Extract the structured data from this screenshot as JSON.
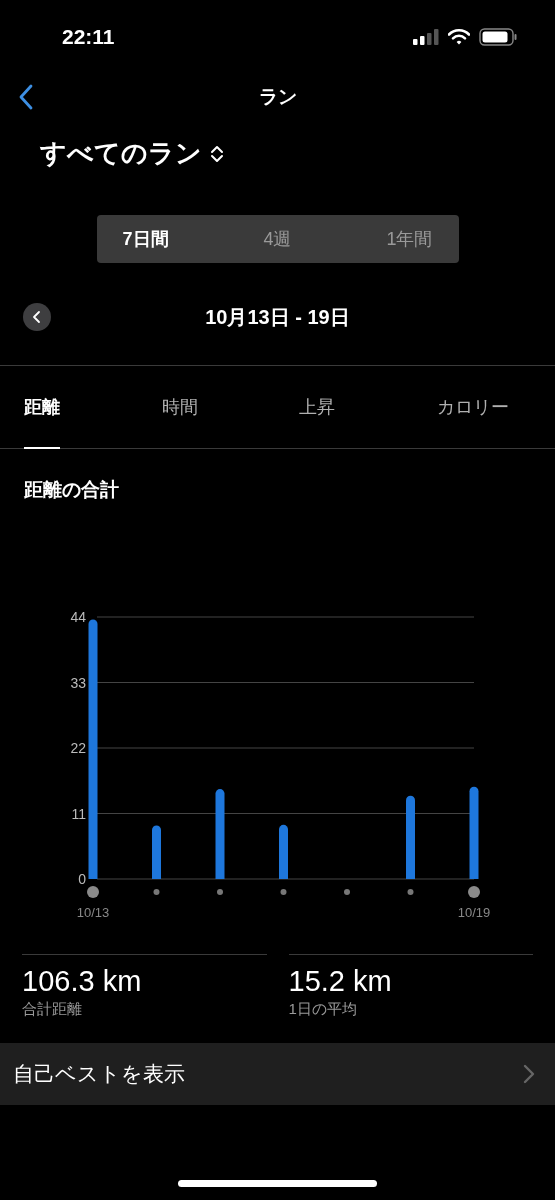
{
  "status_bar": {
    "time": "22:11"
  },
  "nav": {
    "title": "ラン"
  },
  "filter": {
    "label": "すべてのラン"
  },
  "period_tabs": [
    {
      "label": "7日間",
      "selected": true
    },
    {
      "label": "4週",
      "selected": false
    },
    {
      "label": "1年間",
      "selected": false
    }
  ],
  "date_range": {
    "label": "10月13日 - 19日"
  },
  "metric_tabs": [
    {
      "label": "距離",
      "selected": true
    },
    {
      "label": "時間",
      "selected": false
    },
    {
      "label": "上昇",
      "selected": false
    },
    {
      "label": "カロリー",
      "selected": false
    }
  ],
  "section": {
    "title": "距離の合計",
    "chart_data": {
      "type": "bar",
      "categories": [
        "10/13",
        null,
        null,
        null,
        null,
        null,
        "10/19"
      ],
      "values": [
        43.6,
        9.0,
        15.1,
        9.1,
        0,
        14.0,
        15.5
      ],
      "ylim": [
        0,
        44
      ],
      "yticks": [
        0,
        11,
        22,
        33,
        44
      ],
      "grid": true
    }
  },
  "stats": [
    {
      "value": "106.3 km",
      "label": "合計距離"
    },
    {
      "value": "15.2 km",
      "label": "1日の平均"
    }
  ],
  "personal_best": {
    "label": "自己ベストを表示"
  }
}
